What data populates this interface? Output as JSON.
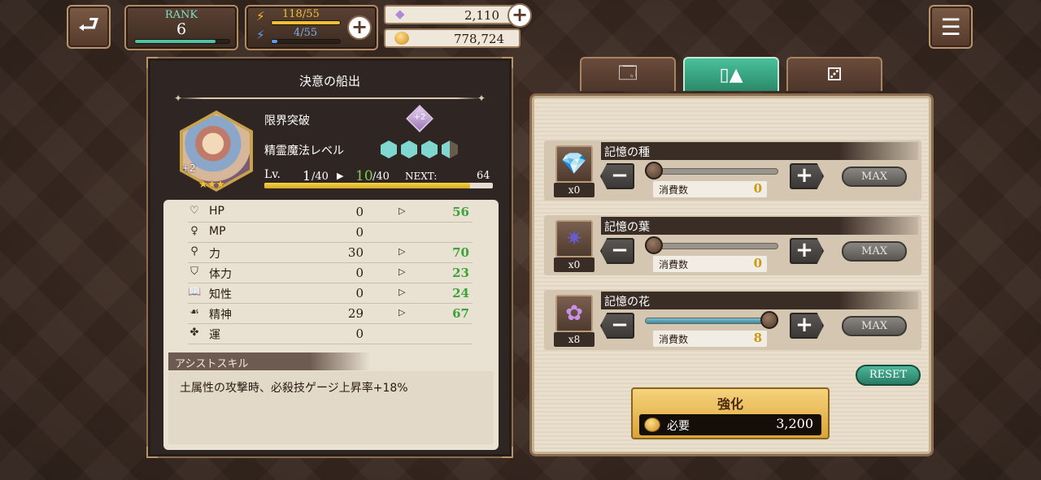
{
  "header": {
    "rank_label": "RANK",
    "rank_value": "6",
    "rank_progress": 0.85,
    "stamina": "118/55",
    "stamina_progress": 1.0,
    "mana": "4/55",
    "mana_progress": 0.08,
    "gems": "2,110",
    "gold": "778,724"
  },
  "left": {
    "title": "決意の船出",
    "limit_break_label": "限界突破",
    "limit_break_badge": "+2",
    "spirit_magic_label": "精霊魔法レベル",
    "portrait_plus": "+2",
    "stars": "★★★",
    "lv_label": "Lv.",
    "lv_current": "1",
    "lv_current_max": "/40",
    "lv_new": "10",
    "lv_new_max": "/40",
    "next_label": "NEXT:",
    "next_value": "64",
    "exp_progress": 0.9,
    "stats": [
      {
        "name": "HP",
        "base": "0",
        "arrow": "▷",
        "new": "56"
      },
      {
        "name": "MP",
        "base": "0",
        "arrow": "",
        "new": ""
      },
      {
        "name": "力",
        "base": "30",
        "arrow": "▷",
        "new": "70"
      },
      {
        "name": "体力",
        "base": "0",
        "arrow": "▷",
        "new": "23"
      },
      {
        "name": "知性",
        "base": "0",
        "arrow": "▷",
        "new": "24"
      },
      {
        "name": "精神",
        "base": "29",
        "arrow": "▷",
        "new": "67"
      },
      {
        "name": "運",
        "base": "0",
        "arrow": "",
        "new": ""
      }
    ],
    "assist_header": "アシストスキル",
    "assist_text": "土属性の攻撃時、必殺技ゲージ上昇率+18%"
  },
  "right": {
    "materials": [
      {
        "name": "記憶の種",
        "count": "x0",
        "consume_label": "消費数",
        "consume": "0",
        "slider_level": 0,
        "max_label": "MAX"
      },
      {
        "name": "記憶の葉",
        "count": "x0",
        "consume_label": "消費数",
        "consume": "0",
        "slider_level": 0,
        "max_label": "MAX"
      },
      {
        "name": "記憶の花",
        "count": "x8",
        "consume_label": "消費数",
        "consume": "8",
        "slider_level": 1,
        "max_label": "MAX"
      }
    ],
    "reset_label": "RESET",
    "enhance_label": "強化",
    "need_label": "必要",
    "cost": "3,200"
  },
  "colors": {
    "accent_green": "#3aa33a",
    "consume_gold": "#c99a10",
    "tab_active": "#2a8a6a"
  }
}
